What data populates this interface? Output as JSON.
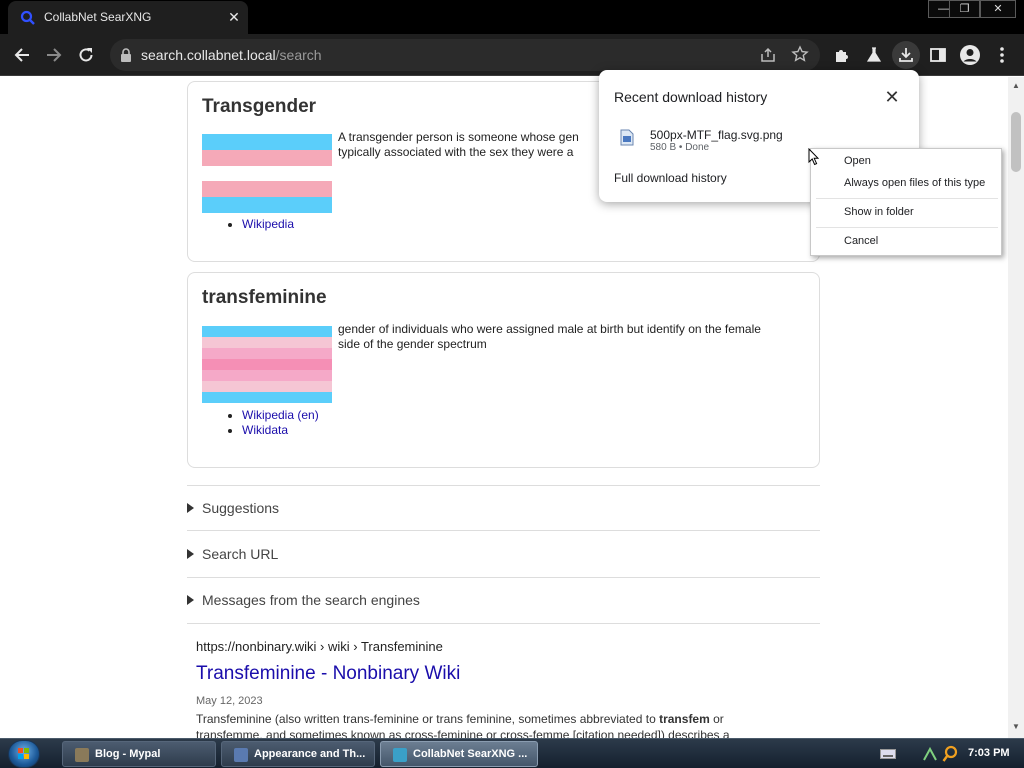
{
  "browser": {
    "tab_title": "CollabNet SearXNG",
    "tab_close_glyph": "✕",
    "url_host": "search.collabnet.local",
    "url_path": "/search",
    "window_buttons": [
      "—",
      "❐",
      "✕"
    ]
  },
  "infobox_transgender": {
    "title": "Transgender",
    "description_line1": "A transgender person is someone whose gen",
    "description_line2": "typically associated with the sex they were a",
    "links": [
      "Wikipedia"
    ],
    "flag_colors": [
      "#5bcefa",
      "#f5a9b8",
      "#ffffff"
    ]
  },
  "infobox_transfeminine": {
    "title": "transfeminine",
    "description_line1": "gender of individuals who were assigned male at birth but identify on the female",
    "description_line2": "side of the gender spectrum",
    "links": [
      "Wikipedia (en)",
      "Wikidata"
    ],
    "flag_colors": [
      "#5bcefa",
      "#f5c6d4",
      "#f5a9c8",
      "#f58fb5"
    ]
  },
  "sections": [
    "Suggestions",
    "Search URL",
    "Messages from the search engines"
  ],
  "result": {
    "breadcrumb": "https://nonbinary.wiki  › wiki › Transfeminine",
    "title": "Transfeminine - Nonbinary Wiki",
    "date": "May 12, 2023",
    "snippet_before_bold": "Transfeminine (also written trans-feminine or trans feminine, sometimes abbreviated to ",
    "snippet_bold": "transfem",
    "snippet_after_bold": " or transfemme, and sometimes known as cross-feminine or cross-femme [citation needed]) describes a"
  },
  "downloads": {
    "title": "Recent download history",
    "file_name": "500px-MTF_flag.svg.png",
    "file_status": "580 B • Done",
    "full_history": "Full download history",
    "close_glyph": "✕"
  },
  "context_menu": {
    "open": "Open",
    "always_open": "Always open files of this type",
    "show_in_folder": "Show in folder",
    "cancel": "Cancel"
  },
  "taskbar": {
    "tasks": [
      {
        "label": "Blog - Mypal",
        "icon_color": "#8a7a5a"
      },
      {
        "label": "Appearance and Th...",
        "icon_color": "#5a7ab0"
      },
      {
        "label": "CollabNet SearXNG ...",
        "icon_color": "#3aa0c8"
      }
    ],
    "time": "7:03 PM"
  },
  "colors": {
    "link": "#1a0dab",
    "chrome_bg": "#1f1f1f",
    "omnibox_bg": "#2b2b2b"
  }
}
